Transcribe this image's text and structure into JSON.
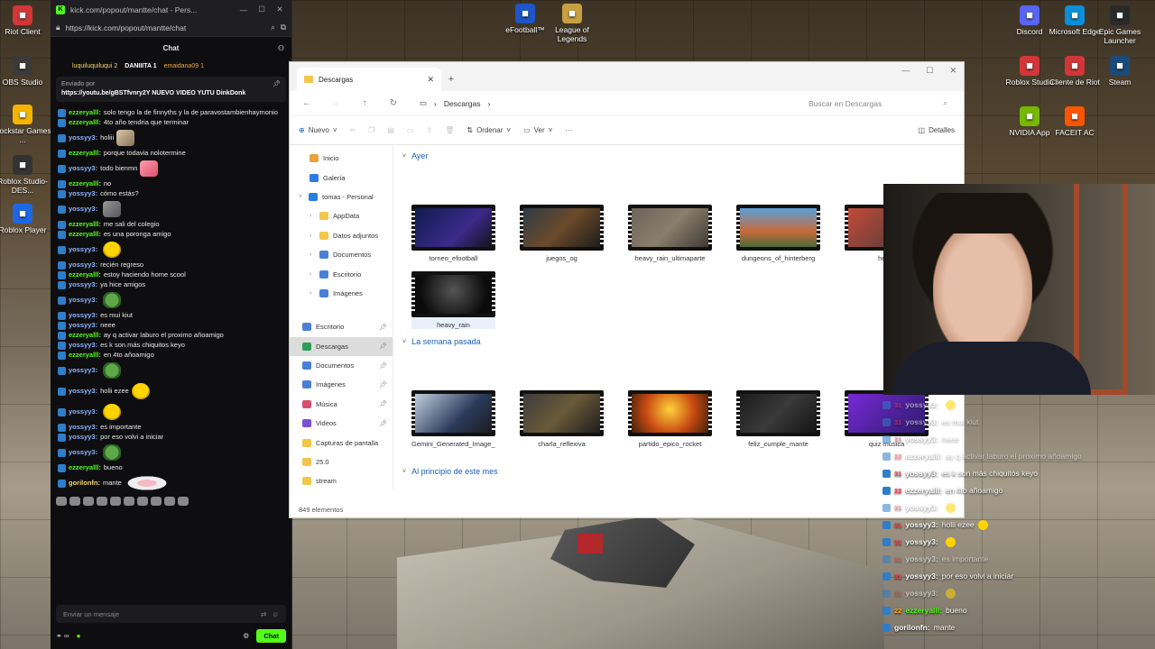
{
  "desktop": {
    "left_icons": [
      {
        "label": "Riot Client",
        "color": "#d13639"
      },
      {
        "label": "OBS Studio",
        "color": "#3a3a3a"
      },
      {
        "label": "Rockstar Games ...",
        "color": "#f4b400"
      },
      {
        "label": "Roblox Studio-DES...",
        "color": "#333333"
      },
      {
        "label": "Roblox Player",
        "color": "#1d67e5"
      }
    ],
    "top_icons": [
      {
        "label": "eFootball™",
        "color": "#1e55c8"
      },
      {
        "label": "League of Legends",
        "color": "#c8a042"
      }
    ],
    "right_icons": [
      {
        "label": "Discord",
        "color": "#5865f2"
      },
      {
        "label": "Microsoft Edge",
        "color": "#0c8fd6"
      },
      {
        "label": "Epic Games Launcher",
        "color": "#2a2a2a"
      },
      {
        "label": "Roblox Studio",
        "color": "#d13639"
      },
      {
        "label": "Cliente de Riot",
        "color": "#d13639"
      },
      {
        "label": "Steam",
        "color": "#1b4b7a"
      },
      {
        "label": "NVIDIA App",
        "color": "#76b900"
      },
      {
        "label": "FACEIT AC",
        "color": "#ff5500"
      }
    ]
  },
  "chat_window": {
    "title": "kick.com/popout/mantte/chat - Pers...",
    "url": "https://kick.com/popout/mantte/chat",
    "header": "Chat",
    "top_gifters": [
      "luquiluquiluqui 2",
      "DANIIITA 1",
      "emaidana09 1"
    ],
    "pinned": {
      "by_prefix": "Enviado por",
      "message": "https://youtu.be/gBSTfvnry2Y NUEVO VIDEO YUTU DinkDonk"
    },
    "messages": [
      {
        "user": "ezzeryalll:",
        "color": "green",
        "text": "solo tengo la de finnyths y la de paravostambienhaymonio",
        "emote": ""
      },
      {
        "user": "ezzeryalll:",
        "color": "green",
        "text": "4to año tendria que terminar",
        "emote": ""
      },
      {
        "user": "yossyy3:",
        "color": "blue",
        "text": "holiii",
        "emote": "cat"
      },
      {
        "user": "ezzeryalll:",
        "color": "green",
        "text": "porque todavia nolotermine",
        "emote": ""
      },
      {
        "user": "yossyy3:",
        "color": "blue",
        "text": "todo bienmn",
        "emote": "pink"
      },
      {
        "user": "ezzeryalll:",
        "color": "green",
        "text": "no",
        "emote": ""
      },
      {
        "user": "yossyy3:",
        "color": "blue",
        "text": "cómo estás?",
        "emote": ""
      },
      {
        "user": "yossyy3:",
        "color": "blue",
        "text": "",
        "emote": "grey"
      },
      {
        "user": "ezzeryalll:",
        "color": "green",
        "text": "me sali del colegio",
        "emote": ""
      },
      {
        "user": "ezzeryalll:",
        "color": "green",
        "text": "es una poronga amigo",
        "emote": ""
      },
      {
        "user": "yossyy3:",
        "color": "blue",
        "text": "",
        "emote": "yellow"
      },
      {
        "user": "yossyy3:",
        "color": "blue",
        "text": "recién regreso",
        "emote": ""
      },
      {
        "user": "ezzeryalll:",
        "color": "green",
        "text": "estoy haciendo home scool",
        "emote": ""
      },
      {
        "user": "yossyy3:",
        "color": "blue",
        "text": "ya hice amigos",
        "emote": ""
      },
      {
        "user": "yossyy3:",
        "color": "blue",
        "text": "",
        "emote": "frog"
      },
      {
        "user": "yossyy3:",
        "color": "blue",
        "text": "es mui kiut",
        "emote": ""
      },
      {
        "user": "yossyy3:",
        "color": "blue",
        "text": "neee",
        "emote": ""
      },
      {
        "user": "ezzeryalll:",
        "color": "green",
        "text": "ay q activar laburo el proximo añoamigo",
        "emote": ""
      },
      {
        "user": "yossyy3:",
        "color": "blue",
        "text": "es k son más chiquitos keyo",
        "emote": ""
      },
      {
        "user": "ezzeryalll:",
        "color": "green",
        "text": "en 4to añoamigo",
        "emote": ""
      },
      {
        "user": "yossyy3:",
        "color": "blue",
        "text": "",
        "emote": "frog"
      },
      {
        "user": "yossyy3:",
        "color": "blue",
        "text": "holii ezee",
        "emote": "yellow"
      },
      {
        "user": "yossyy3:",
        "color": "blue",
        "text": "",
        "emote": "yellow"
      },
      {
        "user": "yossyy3:",
        "color": "blue",
        "text": "es importante",
        "emote": ""
      },
      {
        "user": "yossyy3:",
        "color": "blue",
        "text": "por eso volvi a iniciar",
        "emote": ""
      },
      {
        "user": "yossyy3:",
        "color": "blue",
        "text": "",
        "emote": "frog"
      },
      {
        "user": "ezzeryalll:",
        "color": "green",
        "text": "bueno",
        "emote": ""
      },
      {
        "user": "gorilonfn:",
        "color": "gold",
        "text": "mante",
        "emote": "wings"
      }
    ],
    "input_placeholder": "Enviar un mensaje",
    "chat_button": "Chat"
  },
  "explorer": {
    "tab_title": "Descargas",
    "breadcrumb": "Descargas",
    "search_placeholder": "Buscar en Descargas",
    "toolbar": {
      "new": "Nuevo",
      "sort": "Ordenar",
      "view": "Ver",
      "details": "Detalles"
    },
    "sidebar": [
      {
        "label": "Inicio",
        "color": "#e8a33d",
        "level": 1,
        "pin": false,
        "chev": false
      },
      {
        "label": "Galería",
        "color": "#2b7be4",
        "level": 1,
        "pin": false,
        "chev": false
      },
      {
        "label": "tomas - Personal",
        "color": "#2b7be4",
        "level": 0,
        "pin": false,
        "chev": true
      },
      {
        "label": "AppData",
        "color": "#f3c54b",
        "level": 1,
        "pin": false,
        "chev": true
      },
      {
        "label": "Datos adjuntos",
        "color": "#f3c54b",
        "level": 1,
        "pin": false,
        "chev": true
      },
      {
        "label": "Documentos",
        "color": "#4a7fd8",
        "level": 1,
        "pin": false,
        "chev": true
      },
      {
        "label": "Escritorio",
        "color": "#4a7fd8",
        "level": 1,
        "pin": false,
        "chev": true
      },
      {
        "label": "Imágenes",
        "color": "#4a7fd8",
        "level": 1,
        "pin": false,
        "chev": true
      },
      {
        "label": "Escritorio",
        "color": "#4a7fd8",
        "level": 2,
        "pin": true,
        "chev": false,
        "gap": true
      },
      {
        "label": "Descargas",
        "color": "#2a9d5a",
        "level": 2,
        "pin": true,
        "chev": false,
        "selected": true
      },
      {
        "label": "Documentos",
        "color": "#4a7fd8",
        "level": 2,
        "pin": true,
        "chev": false
      },
      {
        "label": "Imágenes",
        "color": "#4a7fd8",
        "level": 2,
        "pin": true,
        "chev": false
      },
      {
        "label": "Música",
        "color": "#d94f6a",
        "level": 2,
        "pin": true,
        "chev": false
      },
      {
        "label": "Videos",
        "color": "#7b4fd9",
        "level": 2,
        "pin": true,
        "chev": false
      },
      {
        "label": "Capturas de pantalla",
        "color": "#f3c54b",
        "level": 2,
        "pin": false,
        "chev": false
      },
      {
        "label": "25.0",
        "color": "#f3c54b",
        "level": 2,
        "pin": false,
        "chev": false
      },
      {
        "label": "stream",
        "color": "#f3c54b",
        "level": 2,
        "pin": false,
        "chev": false
      }
    ],
    "groups": [
      {
        "title": "Ayer",
        "rows": [
          [
            {
              "name": "torneo_efootball",
              "thumb": "linear-gradient(135deg,#0d1b4a,#3b2a8a 60%,#111)"
            },
            {
              "name": "juegos_og",
              "thumb": "linear-gradient(135deg,#2a3a48,#6b4a2a 50%,#1a1a1a)"
            },
            {
              "name": "heavy_rain_ultimaparte",
              "thumb": "linear-gradient(135deg,#6a6258,#8a7e6c 50%,#3a362f)"
            },
            {
              "name": "dungeons_of_hinterberg",
              "thumb": "linear-gradient(180deg,#5aa0d8,#c86a3a 60%,#4a6a3a)"
            },
            {
              "name": "hea...",
              "thumb": "linear-gradient(135deg,#c84a3a,#3a3a3a)"
            }
          ],
          [
            {
              "name": "heavy_rain",
              "thumb": "radial-gradient(circle at 50% 40%,#555,#0b0b0b 70%)",
              "selected": true
            }
          ]
        ]
      },
      {
        "title": "La semana pasada",
        "rows": [
          [
            {
              "name": "Gemini_Generated_Image_9gqc349gqc349gqc",
              "thumb": "linear-gradient(135deg,#c9d6e6,#2a3a5a 60%,#1a1a1a)"
            },
            {
              "name": "charla_reflexiva",
              "thumb": "linear-gradient(135deg,#3a3a3a,#6a5a3a 50%,#1a1a1a)"
            },
            {
              "name": "partido_epico_rocket",
              "thumb": "radial-gradient(circle at 50% 40%,#ffd23a,#c84a12 50%,#2a1a0a)"
            },
            {
              "name": "feliz_cumple_mante",
              "thumb": "linear-gradient(135deg,#1a1a1a,#3a3a3a 50%,#111)"
            },
            {
              "name": "quiz música",
              "thumb": "linear-gradient(135deg,#7a2ad8,#2a1a6a)"
            }
          ]
        ]
      },
      {
        "title": "Al principio de este mes",
        "rows": []
      }
    ],
    "status": "849 elementos"
  },
  "overlay_chat": [
    {
      "lvl": "31",
      "user": "yossyy3:",
      "msg": "",
      "emote": true,
      "faded": true
    },
    {
      "lvl": "31",
      "user": "yossyy3:",
      "msg": "es mui kiut",
      "emote": false,
      "faded": true
    },
    {
      "lvl": "31",
      "user": "yossyy3:",
      "msg": "neee",
      "emote": false,
      "faded": true
    },
    {
      "lvl": "22",
      "user": "ezzeryalll:",
      "msg": "ay q activar laburo el proximo añoamigo",
      "emote": false,
      "faded": true
    },
    {
      "lvl": "31",
      "user": "yossyy3:",
      "msg": "es k son más chiquitos keyo",
      "emote": false,
      "faded": false
    },
    {
      "lvl": "22",
      "user": "ezzeryalll:",
      "msg": "en 4to añoamigo",
      "emote": false,
      "faded": false
    },
    {
      "lvl": "31",
      "user": "yossyy3:",
      "msg": "",
      "emote": true,
      "faded": true
    },
    {
      "lvl": "31",
      "user": "yossyy3:",
      "msg": "holii ezee",
      "emote": true,
      "faded": false
    },
    {
      "lvl": "31",
      "user": "yossyy3:",
      "msg": "",
      "emote": true,
      "faded": false
    },
    {
      "lvl": "31",
      "user": "yossyy3:",
      "msg": "es importante",
      "emote": false,
      "faded": true
    },
    {
      "lvl": "31",
      "user": "yossyy3:",
      "msg": "por eso volvi a iniciar",
      "emote": false,
      "faded": false
    },
    {
      "lvl": "31",
      "user": "yossyy3:",
      "msg": "",
      "emote": true,
      "faded": true
    },
    {
      "lvl": "22",
      "user": "ezzeryalll:",
      "msg": "bueno",
      "emote": false,
      "faded": false,
      "gold": true
    },
    {
      "lvl": "",
      "user": "gorilonfn:",
      "msg": "mante",
      "emote": false,
      "faded": false
    }
  ]
}
